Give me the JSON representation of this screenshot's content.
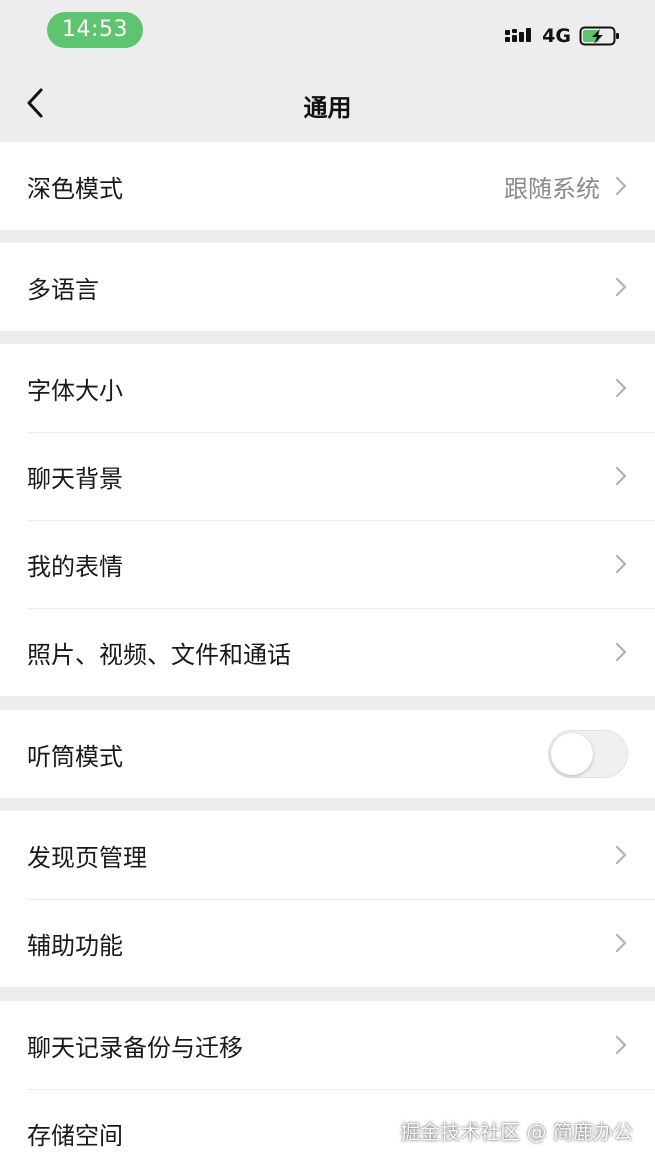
{
  "status_bar": {
    "time": "14:53",
    "network": "4G",
    "icons": [
      "signal-icon",
      "battery-charging-icon"
    ],
    "accent_color": "#5fc46f"
  },
  "nav": {
    "title": "通用",
    "back_icon": "chevron-left-icon"
  },
  "groups": [
    {
      "rows": [
        {
          "label": "深色模式",
          "value": "跟随系统"
        }
      ]
    },
    {
      "rows": [
        {
          "label": "多语言"
        }
      ]
    },
    {
      "rows": [
        {
          "label": "字体大小"
        },
        {
          "label": "聊天背景"
        },
        {
          "label": "我的表情"
        },
        {
          "label": "照片、视频、文件和通话"
        }
      ]
    },
    {
      "rows": [
        {
          "label": "听筒模式",
          "toggle": false
        }
      ]
    },
    {
      "rows": [
        {
          "label": "发现页管理"
        },
        {
          "label": "辅助功能"
        }
      ]
    },
    {
      "rows": [
        {
          "label": "聊天记录备份与迁移"
        },
        {
          "label": "存储空间"
        }
      ]
    }
  ],
  "watermark": "掘金技术社区 @ 简鹿办公"
}
